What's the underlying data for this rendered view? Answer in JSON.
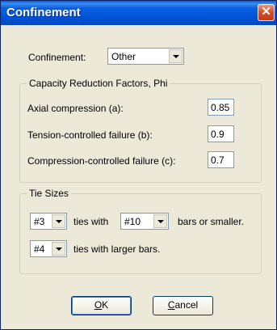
{
  "window": {
    "title": "Confinement",
    "close_glyph": "✕"
  },
  "confinement": {
    "label": "Confinement:",
    "selected": "Other"
  },
  "phi_group": {
    "legend": "Capacity Reduction Factors, Phi",
    "axial_label": "Axial compression (a):",
    "axial_value": "0.85",
    "tension_label": "Tension-controlled failure (b):",
    "tension_value": "0.9",
    "compression_label": "Compression-controlled failure (c):",
    "compression_value": "0.7"
  },
  "tie_group": {
    "legend": "Tie Sizes",
    "tie_size_1": "#3",
    "ties_with_text": "ties with",
    "bar_size": "#10",
    "bars_smaller_text": "bars or smaller.",
    "tie_size_2": "#4",
    "ties_larger_text": "ties with larger bars."
  },
  "buttons": {
    "ok_mnemonic": "O",
    "ok_rest": "K",
    "cancel_mnemonic": "C",
    "cancel_rest": "ancel"
  }
}
